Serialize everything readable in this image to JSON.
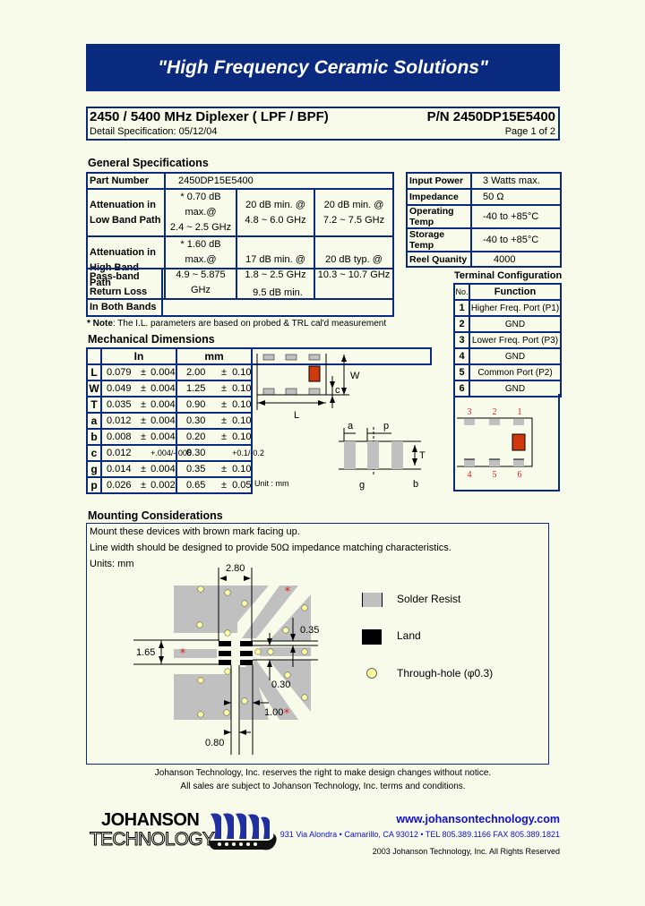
{
  "banner": {
    "slogan": "\"High Frequency Ceramic Solutions\""
  },
  "header": {
    "title": "2450 / 5400 MHz Diplexer ( LPF / BPF)",
    "part_number": "P/N 2450DP15E5400",
    "detail_spec": "Detail Specification:   05/12/04",
    "page": "Page 1 of 2"
  },
  "general": {
    "title": "General Specifications",
    "part_number_label": "Part Number",
    "part_number_value": "2450DP15E5400",
    "low_band": {
      "label1": "Attenuation in",
      "label2": "Low Band Path",
      "cells": [
        [
          "* 0.70 dB max.@",
          "2.4 ~ 2.5 GHz"
        ],
        [
          "20 dB min. @",
          "4.8 ~ 6.0 GHz"
        ],
        [
          "20 dB min. @",
          "7.2 ~ 7.5 GHz"
        ]
      ]
    },
    "high_band": {
      "label1": "Attenuation in",
      "label2": "High Band Path",
      "cells": [
        [
          "* 1.60 dB max.@",
          "4.9 ~ 5.875 GHz"
        ],
        [
          "17 dB min. @",
          "1.8 ~ 2.5 GHz"
        ],
        [
          "20 dB typ. @",
          "10.3 ~ 10.7 GHz"
        ]
      ]
    },
    "ratings": [
      {
        "label": "Input Power",
        "value": "3 Watts max."
      },
      {
        "label": "Impedance",
        "value": "50 Ω"
      },
      {
        "label": "Operating Temp",
        "value": "-40 to +85°C"
      },
      {
        "label": "Storage Temp",
        "value": "-40 to +85°C"
      },
      {
        "label": "Reel Quanity",
        "value": "4000"
      }
    ],
    "passband": {
      "label1": "Pass-band",
      "label2": "Return Loss",
      "label3": "In Both Bands",
      "value": "9.5 dB min."
    },
    "note_bold": "* Note",
    "note_text": ": The I.L. parameters are based on probed & TRL cal'd measurement"
  },
  "mechanical": {
    "title": "Mechanical Dimensions",
    "col_in": "In",
    "col_mm": "mm",
    "rows": [
      {
        "dim": "L",
        "in": "0.079",
        "in_pm": "±",
        "in_tol": "0.004",
        "mm": "2.00",
        "mm_pm": "±",
        "mm_tol": "0.10"
      },
      {
        "dim": "W",
        "in": "0.049",
        "in_pm": "±",
        "in_tol": "0.004",
        "mm": "1.25",
        "mm_pm": "±",
        "mm_tol": "0.10"
      },
      {
        "dim": "T",
        "in": "0.035",
        "in_pm": "±",
        "in_tol": "0.004",
        "mm": "0.90",
        "mm_pm": "±",
        "mm_tol": "0.10"
      },
      {
        "dim": "a",
        "in": "0.012",
        "in_pm": "±",
        "in_tol": "0.004",
        "mm": "0.30",
        "mm_pm": "±",
        "mm_tol": "0.10"
      },
      {
        "dim": "b",
        "in": "0.008",
        "in_pm": "±",
        "in_tol": "0.004",
        "mm": "0.20",
        "mm_pm": "±",
        "mm_tol": "0.10"
      },
      {
        "dim": "c",
        "in": "0.012",
        "in_pm": "",
        "in_tol": "+.004/-.008",
        "mm": "0.30",
        "mm_pm": "",
        "mm_tol": "+0.1/-0.2"
      },
      {
        "dim": "g",
        "in": "0.014",
        "in_pm": "±",
        "in_tol": "0.004",
        "mm": "0.35",
        "mm_pm": "±",
        "mm_tol": "0.10"
      },
      {
        "dim": "p",
        "in": "0.026",
        "in_pm": "±",
        "in_tol": "0.002",
        "mm": "0.65",
        "mm_pm": "±",
        "mm_tol": "0.05"
      }
    ],
    "drawing_labels": {
      "W": "W",
      "c": "c",
      "L": "L",
      "a": "a",
      "p": "p",
      "T": "T",
      "g": "g",
      "b": "b",
      "unit": "Unit : mm"
    }
  },
  "terminal": {
    "title": "Terminal Configuration",
    "col_no": "No.",
    "col_function": "Function",
    "rows": [
      {
        "no": "1",
        "function": "Higher Freq. Port (P1)"
      },
      {
        "no": "2",
        "function": "GND"
      },
      {
        "no": "3",
        "function": "Lower Freq. Port (P3)"
      },
      {
        "no": "4",
        "function": "GND"
      },
      {
        "no": "5",
        "function": "Common Port (P2)"
      },
      {
        "no": "6",
        "function": "GND"
      }
    ],
    "pin_labels_top": [
      "3",
      "2",
      "1"
    ],
    "pin_labels_bottom": [
      "4",
      "5",
      "6"
    ]
  },
  "mounting": {
    "title": "Mounting Considerations",
    "line1": "Mount these devices with brown mark facing up.",
    "line2": "Line width should be designed to provide 50Ω impedance matching characteristics.",
    "line3": "Units: mm",
    "dims": {
      "d280": "2.80",
      "d165": "1.65",
      "d035": "0.35",
      "d030": "0.30",
      "d100": "1.00",
      "d080": "0.80"
    },
    "legend": {
      "solder_resist": "Solder Resist",
      "land": "Land",
      "through_hole": "Through-hole (φ0.3)"
    }
  },
  "footer": {
    "disclaimer1": "Johanson Technology, Inc. reserves the right to make design changes without notice.",
    "disclaimer2": "All sales are subject to Johanson Technology, Inc. terms and conditions.",
    "logo_line1": "JOHANSON",
    "logo_line2": "TECHNOLOGY",
    "url": "www.johansontechnology.com",
    "address": "931 Via Alondra • Camarillo, CA 93012 • TEL 805.389.1166 FAX 805.389.1821",
    "copyright": "2003 Johanson Technology, Inc.  All Rights Reserved"
  },
  "colors": {
    "brand_navy": "#0a2a80",
    "mark_brown": "#d0380e",
    "solder_resist": "#c0c0c0",
    "pin_label": "#d8201a",
    "link_blue": "#1010d0"
  }
}
